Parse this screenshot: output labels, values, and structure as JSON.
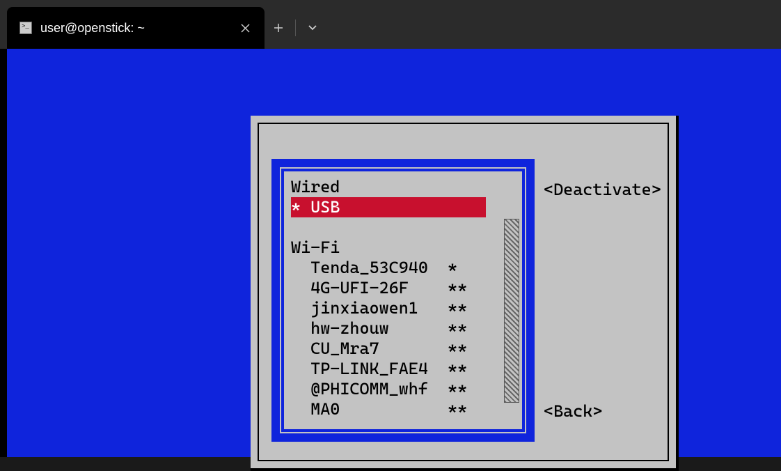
{
  "tab": {
    "title": "user@openstick: ~"
  },
  "network": {
    "wired_header": "Wired",
    "usb_row": "* USB",
    "wifi_header": "Wi-Fi",
    "items": [
      {
        "ssid": "Tenda_53C940",
        "signal": "*"
      },
      {
        "ssid": "4G-UFI-26F",
        "signal": "**"
      },
      {
        "ssid": "jinxiaowen1",
        "signal": "**"
      },
      {
        "ssid": "hw-zhouw",
        "signal": "**"
      },
      {
        "ssid": "CU_Mra7",
        "signal": "**"
      },
      {
        "ssid": "TP-LINK_FAE4",
        "signal": "**"
      },
      {
        "ssid": "@PHICOMM_whf",
        "signal": "**"
      },
      {
        "ssid": "MA0",
        "signal": "**"
      }
    ]
  },
  "buttons": {
    "deactivate": "<Deactivate>",
    "back": "<Back>"
  }
}
